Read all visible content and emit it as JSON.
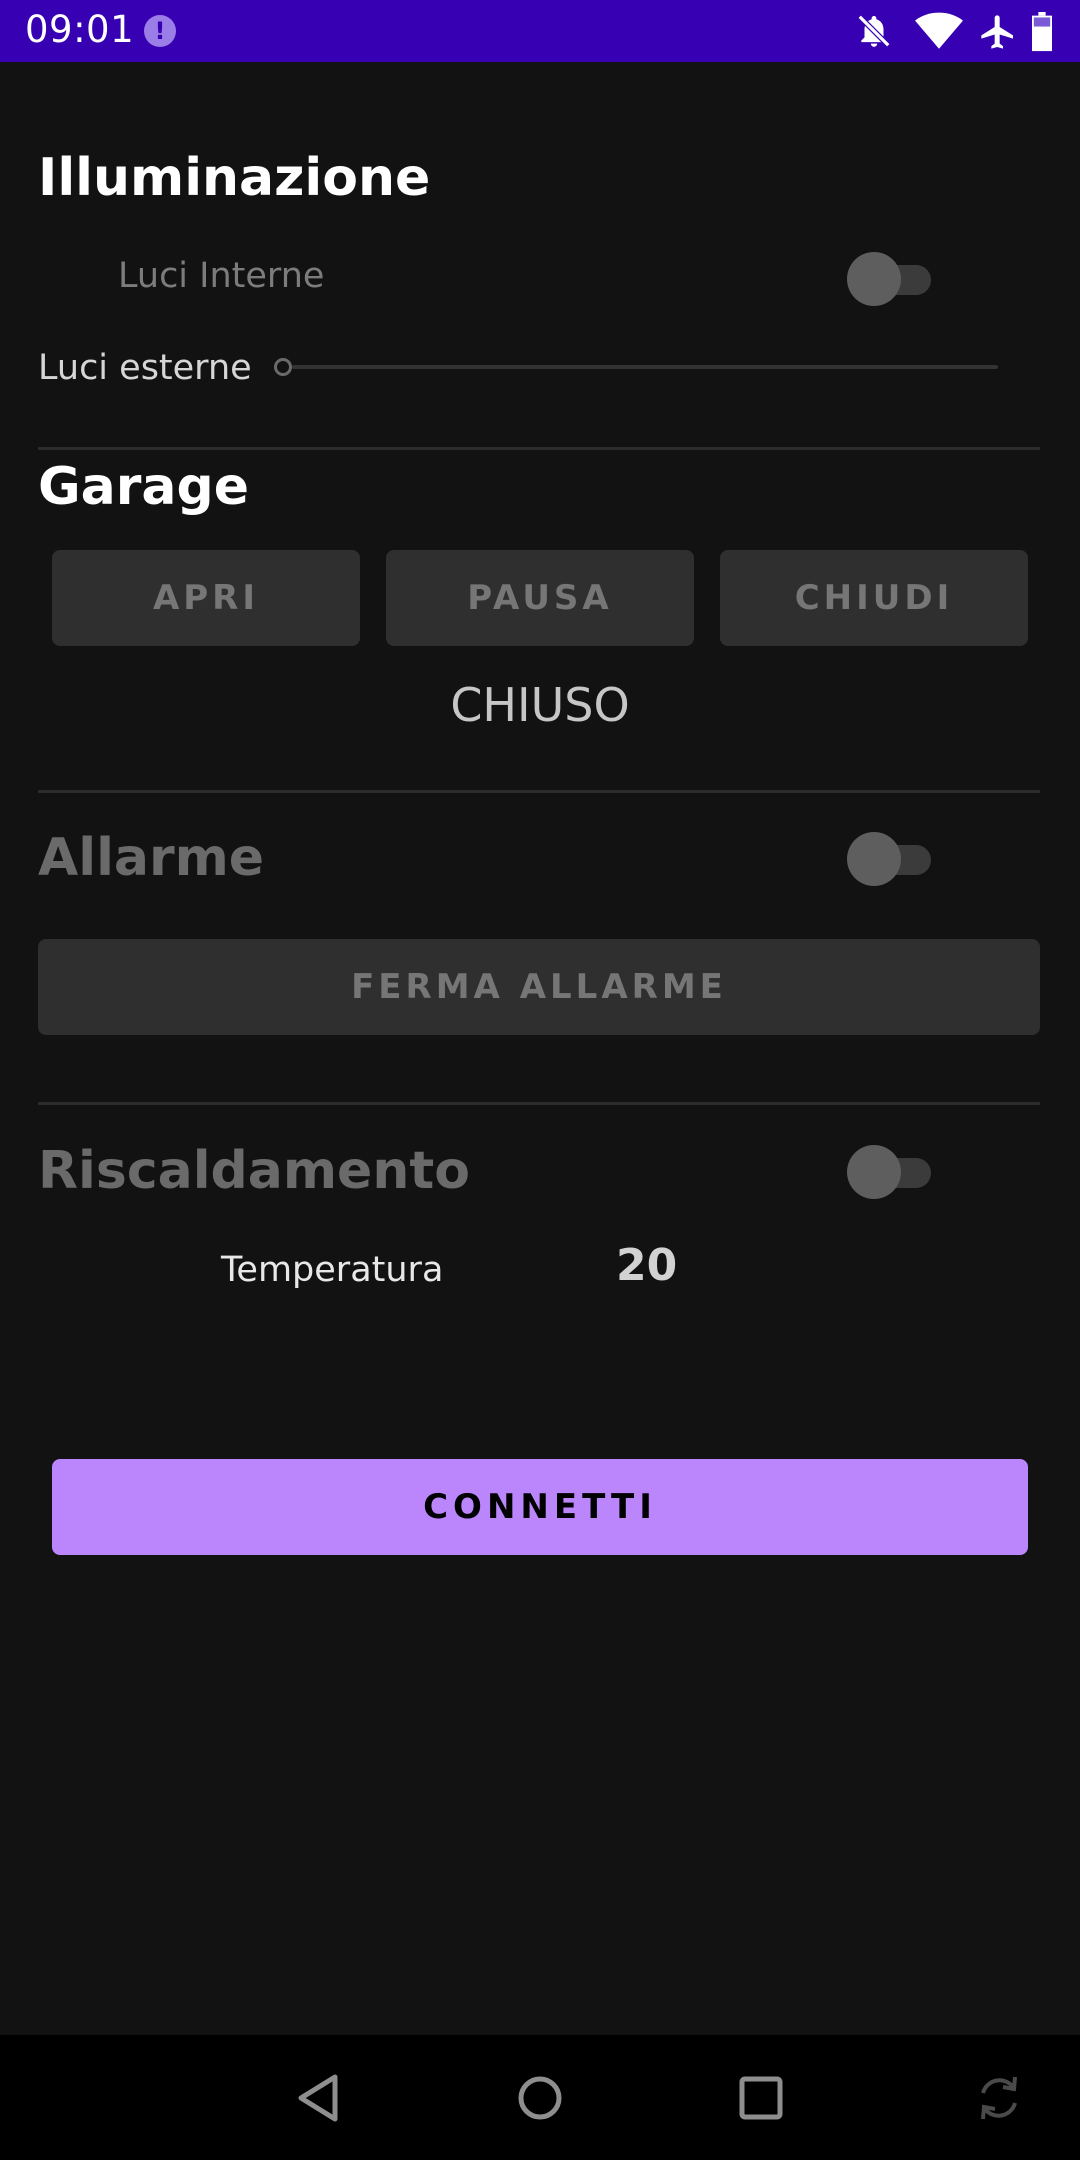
{
  "status_bar": {
    "time": "09:01",
    "alert_glyph": "!",
    "icons": [
      "alert-circle-icon",
      "notifications-off-icon",
      "wifi-icon",
      "airplane-icon",
      "battery-icon"
    ],
    "bg_color": "#3700b3"
  },
  "lighting": {
    "title": "Illuminazione",
    "interior_label": "Luci Interne",
    "interior_on": false,
    "exterior_label": "Luci esterne",
    "exterior_level": 0
  },
  "garage": {
    "title": "Garage",
    "open_label": "APRI",
    "pause_label": "PAUSA",
    "close_label": "CHIUDI",
    "state": "CHIUSO"
  },
  "alarm": {
    "title": "Allarme",
    "enabled": false,
    "stop_label": "FERMA ALLARME"
  },
  "heating": {
    "title": "Riscaldamento",
    "enabled": false,
    "temp_label": "Temperatura",
    "temp_value": "20"
  },
  "connect": {
    "label": "CONNETTI",
    "color": "#bb86fc"
  },
  "nav": {
    "icons": [
      "back-icon",
      "home-icon",
      "recents-icon",
      "rotate-icon"
    ]
  }
}
